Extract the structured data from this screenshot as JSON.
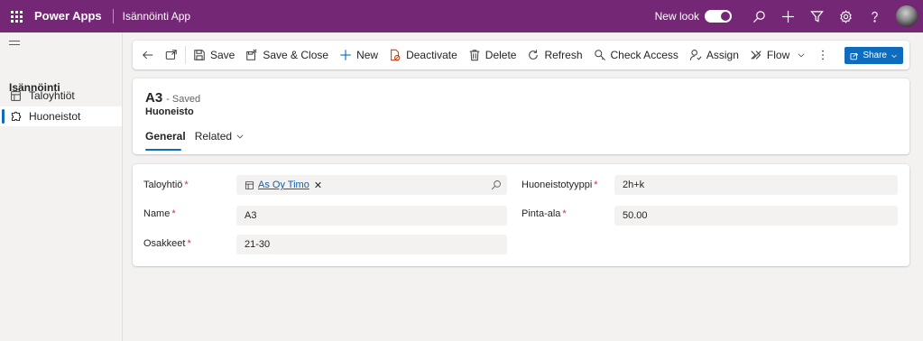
{
  "topbar": {
    "brand": "Power Apps",
    "app_name": "Isännöinti App",
    "new_look_label": "New look"
  },
  "sidebar": {
    "group_label": "Isännöinti",
    "items": [
      {
        "label": "Taloyhtiöt",
        "icon": "building-icon"
      },
      {
        "label": "Huoneistot",
        "icon": "puzzle-icon"
      }
    ]
  },
  "commandbar": {
    "save": "Save",
    "save_close": "Save & Close",
    "new": "New",
    "deactivate": "Deactivate",
    "delete": "Delete",
    "refresh": "Refresh",
    "check_access": "Check Access",
    "assign": "Assign",
    "flow": "Flow",
    "share": "Share"
  },
  "record": {
    "name": "A3",
    "status": "- Saved",
    "entity": "Huoneisto",
    "tabs": [
      {
        "label": "General"
      },
      {
        "label": "Related"
      }
    ]
  },
  "form": {
    "taloyhtio": {
      "label": "Taloyhtiö",
      "value": "As Oy Timo"
    },
    "name": {
      "label": "Name",
      "value": "A3"
    },
    "osakkeet": {
      "label": "Osakkeet",
      "value": "21-30"
    },
    "huoneistotyyppi": {
      "label": "Huoneistotyyppi",
      "value": "2h+k"
    },
    "pinta_ala": {
      "label": "Pinta-ala",
      "value": "50.00"
    },
    "required_mark": "*"
  },
  "colors": {
    "header_bg": "#742774",
    "accent": "#0f6cbd",
    "required": "#c4314b"
  }
}
